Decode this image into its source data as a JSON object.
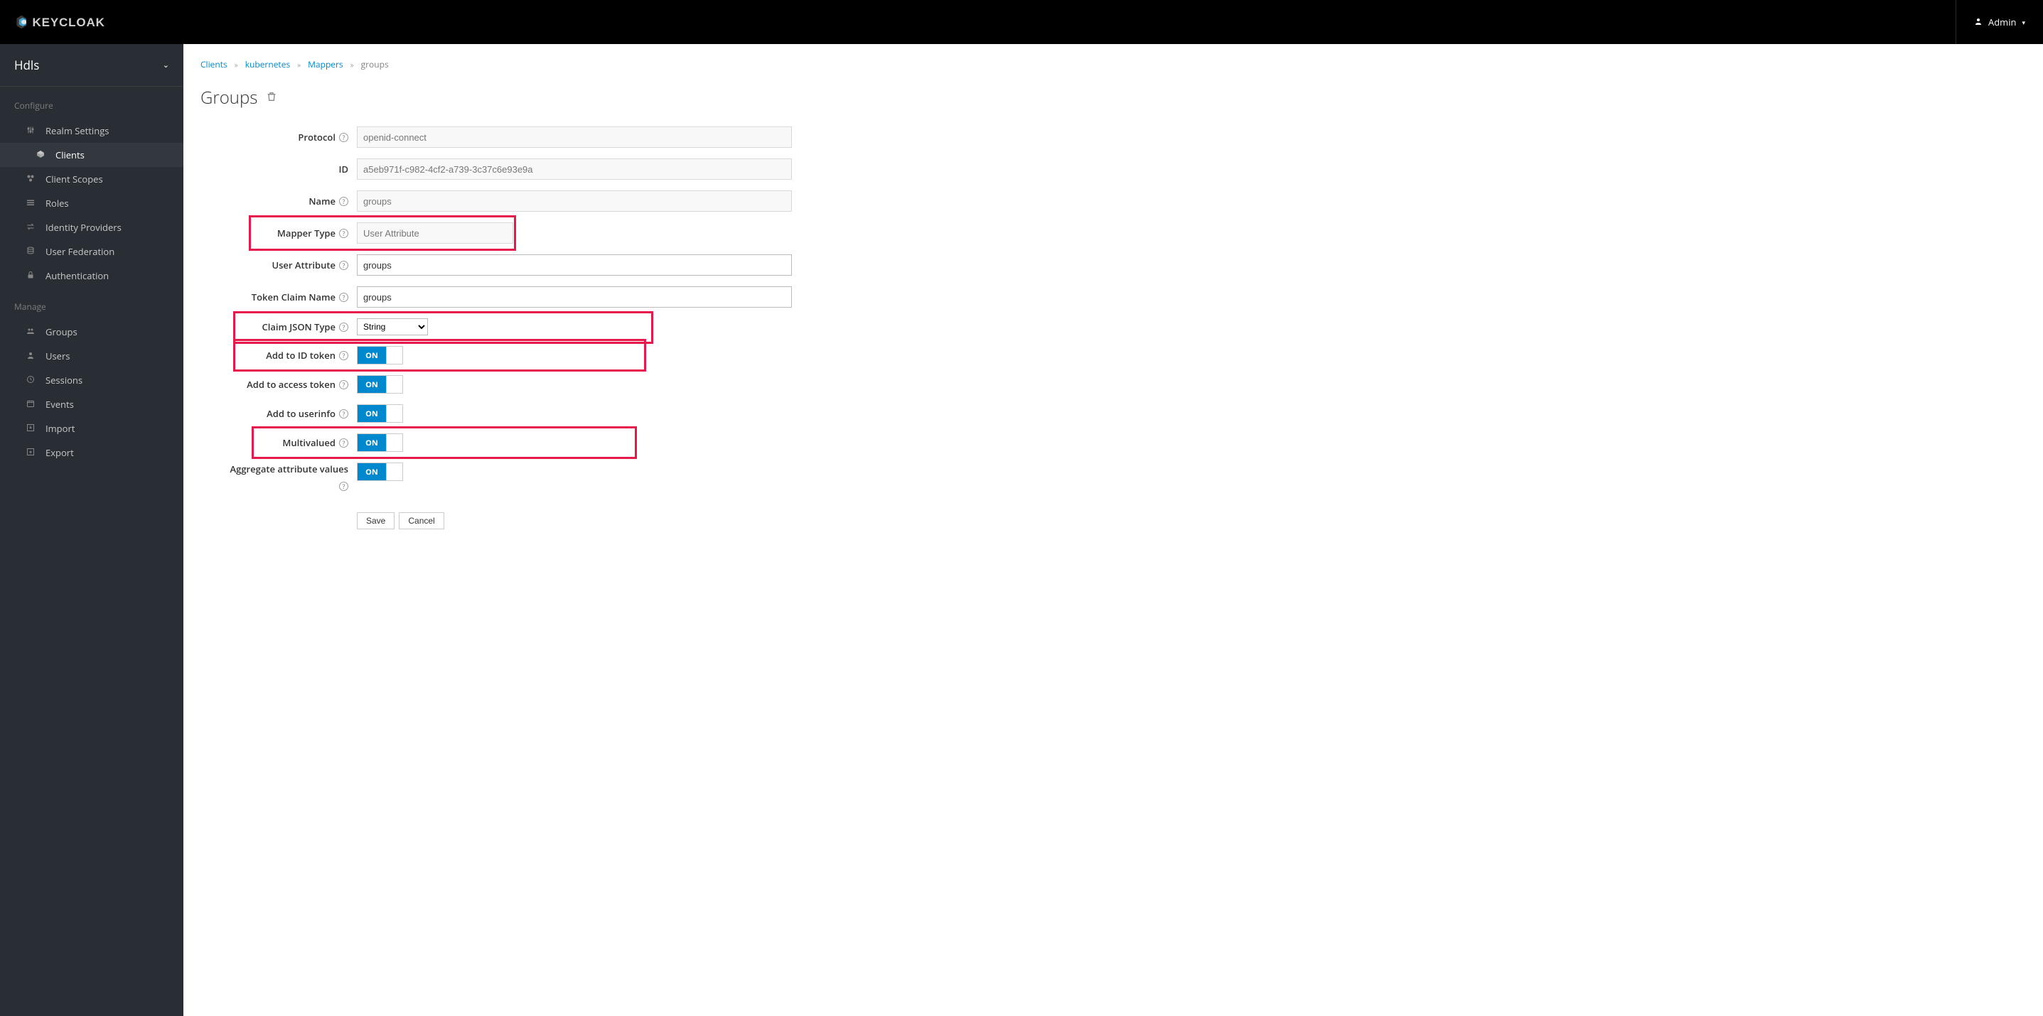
{
  "app": {
    "name": "KEYCLOAK",
    "user": "Admin"
  },
  "realm": "Hdls",
  "sidebar": {
    "configure_label": "Configure",
    "manage_label": "Manage",
    "configure": [
      {
        "label": "Realm Settings"
      },
      {
        "label": "Clients"
      },
      {
        "label": "Client Scopes"
      },
      {
        "label": "Roles"
      },
      {
        "label": "Identity Providers"
      },
      {
        "label": "User Federation"
      },
      {
        "label": "Authentication"
      }
    ],
    "manage": [
      {
        "label": "Groups"
      },
      {
        "label": "Users"
      },
      {
        "label": "Sessions"
      },
      {
        "label": "Events"
      },
      {
        "label": "Import"
      },
      {
        "label": "Export"
      }
    ]
  },
  "breadcrumb": {
    "items": [
      {
        "label": "Clients",
        "link": true
      },
      {
        "label": "kubernetes",
        "link": true
      },
      {
        "label": "Mappers",
        "link": true
      },
      {
        "label": "groups",
        "link": false
      }
    ]
  },
  "title": "Groups",
  "form": {
    "protocol": {
      "label": "Protocol",
      "value": "openid-connect"
    },
    "id": {
      "label": "ID",
      "value": "a5eb971f-c982-4cf2-a739-3c37c6e93e9a"
    },
    "name": {
      "label": "Name",
      "value": "groups"
    },
    "mapper_type": {
      "label": "Mapper Type",
      "value": "User Attribute"
    },
    "user_attribute": {
      "label": "User Attribute",
      "value": "groups"
    },
    "token_claim_name": {
      "label": "Token Claim Name",
      "value": "groups"
    },
    "claim_json_type": {
      "label": "Claim JSON Type",
      "value": "String"
    },
    "add_to_id_token": {
      "label": "Add to ID token",
      "value": "ON"
    },
    "add_to_access_token": {
      "label": "Add to access token",
      "value": "ON"
    },
    "add_to_userinfo": {
      "label": "Add to userinfo",
      "value": "ON"
    },
    "multivalued": {
      "label": "Multivalued",
      "value": "ON"
    },
    "aggregate": {
      "label": "Aggregate attribute values",
      "value": "ON"
    }
  },
  "buttons": {
    "save": "Save",
    "cancel": "Cancel"
  }
}
